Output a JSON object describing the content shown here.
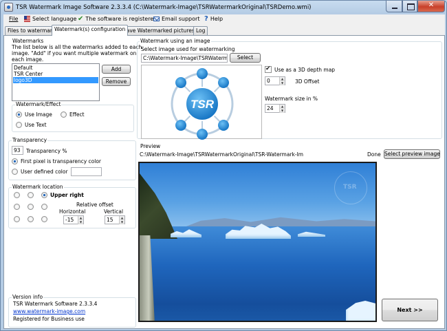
{
  "window": {
    "title": "TSR Watermark Image Software 2.3.3.4 (C:\\Watermark-Image\\TSRWatermarkOriginal\\TSRDemo.wmi)"
  },
  "menu": {
    "file": "File",
    "language": "Select language",
    "registered": "The software is registered",
    "email": "Email support",
    "help": "Help"
  },
  "tabs": [
    {
      "label": "Files to watermark"
    },
    {
      "label": "Watermark(s) configuration"
    },
    {
      "label": "Save Watermarked pictures as"
    },
    {
      "label": "Log"
    }
  ],
  "watermarks": {
    "title": "Watermarks",
    "description_line1": "The list below is all the watermarks added to each",
    "description_line2": "image. \"Add\" if you want multiple watermark on",
    "description_line3": "each image.",
    "items": [
      "Default",
      "TSR Center",
      "logo3D"
    ],
    "selected": "logo3D",
    "add_label": "Add",
    "remove_label": "Remove"
  },
  "effect": {
    "title": "Watermark/Effect",
    "use_image": "Use Image",
    "effect": "Effect",
    "use_text": "Use Text",
    "selected": "Use Image"
  },
  "transparency": {
    "title": "Transparency",
    "value": "93",
    "unit_label": "Transparency %",
    "first_pixel": "First pixel is transparency color",
    "user_defined": "User defined color",
    "selected": "First pixel is transparency color"
  },
  "location": {
    "title": "Watermark location",
    "selected_label": "Upper right",
    "offset_label": "Relative offset",
    "horizontal_label": "Horizontal",
    "vertical_label": "Vertical",
    "horizontal_value": "-15",
    "vertical_value": "15"
  },
  "version": {
    "title": "Version info",
    "line1": "TSR Watermark Software 2.3.3.4",
    "link": "www.watermark-image.com",
    "line3": "Registered for Business use"
  },
  "image_wm": {
    "title": "Watermark using an image",
    "select_label": "Select image used for watermarking",
    "path": "C:\\Watermark-Image\\TSRWatermark\\",
    "select_button": "Select",
    "logo_text": "TSR",
    "depth_label": "Use as a 3D depth map",
    "depth_checked": true,
    "offset_value": "0",
    "offset_label": "3D Offset",
    "size_label": "Watermark size in %",
    "size_value": "24"
  },
  "preview": {
    "title": "Preview",
    "path": "C:\\Watermark-Image\\TSRWatermarkOriginal\\TSR-Watermark-Im",
    "status": "Done",
    "button": "Select preview image"
  },
  "next_label": "Next >>",
  "colors": {
    "accent": "#3399ff",
    "logo_blue": "#1e88d8"
  }
}
